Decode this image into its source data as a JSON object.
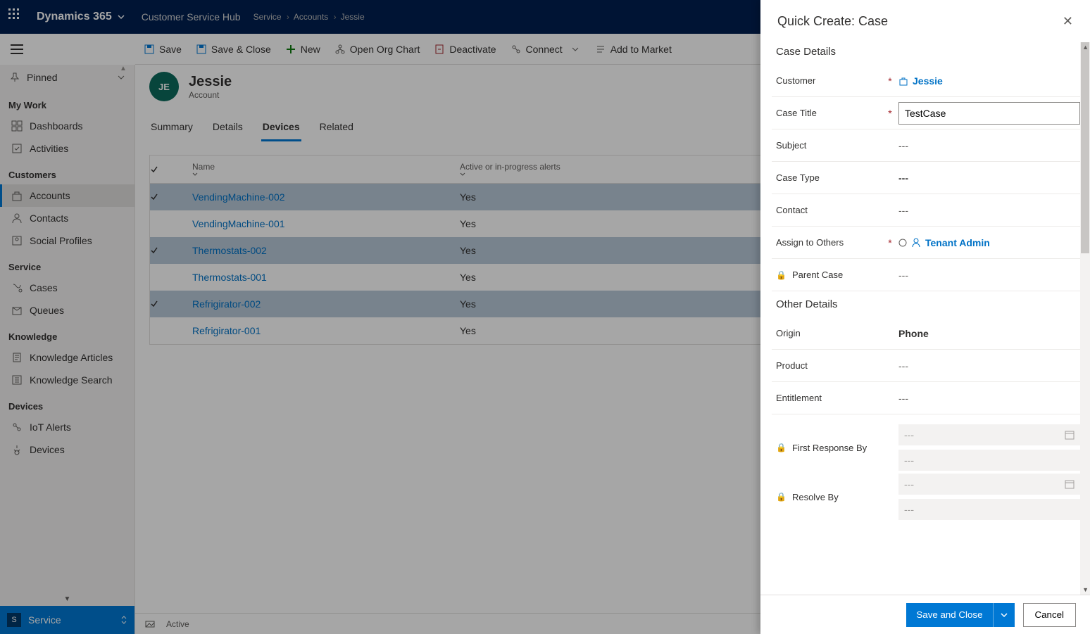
{
  "topnav": {
    "brand": "Dynamics 365",
    "hub": "Customer Service Hub",
    "breadcrumbs": [
      "Service",
      "Accounts",
      "Jessie"
    ]
  },
  "commands": {
    "save": "Save",
    "save_close": "Save & Close",
    "new": "New",
    "open_org": "Open Org Chart",
    "deactivate": "Deactivate",
    "connect": "Connect",
    "add_marketing": "Add to Market"
  },
  "sidebar": {
    "pinned": "Pinned",
    "groups": [
      {
        "label": "My Work",
        "items": [
          {
            "label": "Dashboards",
            "icon": "dashboard"
          },
          {
            "label": "Activities",
            "icon": "activity"
          }
        ]
      },
      {
        "label": "Customers",
        "items": [
          {
            "label": "Accounts",
            "icon": "account",
            "active": true
          },
          {
            "label": "Contacts",
            "icon": "contact"
          },
          {
            "label": "Social Profiles",
            "icon": "social"
          }
        ]
      },
      {
        "label": "Service",
        "items": [
          {
            "label": "Cases",
            "icon": "case"
          },
          {
            "label": "Queues",
            "icon": "queue"
          }
        ]
      },
      {
        "label": "Knowledge",
        "items": [
          {
            "label": "Knowledge Articles",
            "icon": "article"
          },
          {
            "label": "Knowledge Search",
            "icon": "search"
          }
        ]
      },
      {
        "label": "Devices",
        "items": [
          {
            "label": "IoT Alerts",
            "icon": "alert"
          },
          {
            "label": "Devices",
            "icon": "device"
          }
        ]
      }
    ],
    "area_letter": "S",
    "area": "Service"
  },
  "record": {
    "initials": "JE",
    "name": "Jessie",
    "type": "Account"
  },
  "tabs": [
    "Summary",
    "Details",
    "Devices",
    "Related"
  ],
  "active_tab": "Devices",
  "grid": {
    "columns": {
      "name": "Name",
      "alerts": "Active or in-progress alerts"
    },
    "rows": [
      {
        "name": "VendingMachine-002",
        "alerts": "Yes",
        "selected": true
      },
      {
        "name": "VendingMachine-001",
        "alerts": "Yes",
        "selected": false
      },
      {
        "name": "Thermostats-002",
        "alerts": "Yes",
        "selected": true
      },
      {
        "name": "Thermostats-001",
        "alerts": "Yes",
        "selected": false
      },
      {
        "name": "Refrigirator-002",
        "alerts": "Yes",
        "selected": true
      },
      {
        "name": "Refrigirator-001",
        "alerts": "Yes",
        "selected": false
      }
    ]
  },
  "statusbar": {
    "status": "Active"
  },
  "panel": {
    "title": "Quick Create: Case",
    "sections": {
      "case_details": "Case Details",
      "other_details": "Other Details"
    },
    "fields": {
      "customer": {
        "label": "Customer",
        "value": "Jessie",
        "required": true
      },
      "case_title": {
        "label": "Case Title",
        "value": "TestCase",
        "required": true
      },
      "subject": {
        "label": "Subject",
        "value": "---"
      },
      "case_type": {
        "label": "Case Type",
        "value": "---"
      },
      "contact": {
        "label": "Contact",
        "value": "---"
      },
      "assign": {
        "label": "Assign to Others",
        "value": "Tenant Admin",
        "required": true
      },
      "parent_case": {
        "label": "Parent Case",
        "value": "---",
        "locked": true
      },
      "origin": {
        "label": "Origin",
        "value": "Phone"
      },
      "product": {
        "label": "Product",
        "value": "---"
      },
      "entitlement": {
        "label": "Entitlement",
        "value": "---"
      },
      "first_response": {
        "label": "First Response By",
        "value1": "---",
        "value2": "---",
        "locked": true
      },
      "resolve_by": {
        "label": "Resolve By",
        "value1": "---",
        "value2": "---",
        "locked": true
      }
    },
    "buttons": {
      "save_close": "Save and Close",
      "cancel": "Cancel"
    }
  }
}
